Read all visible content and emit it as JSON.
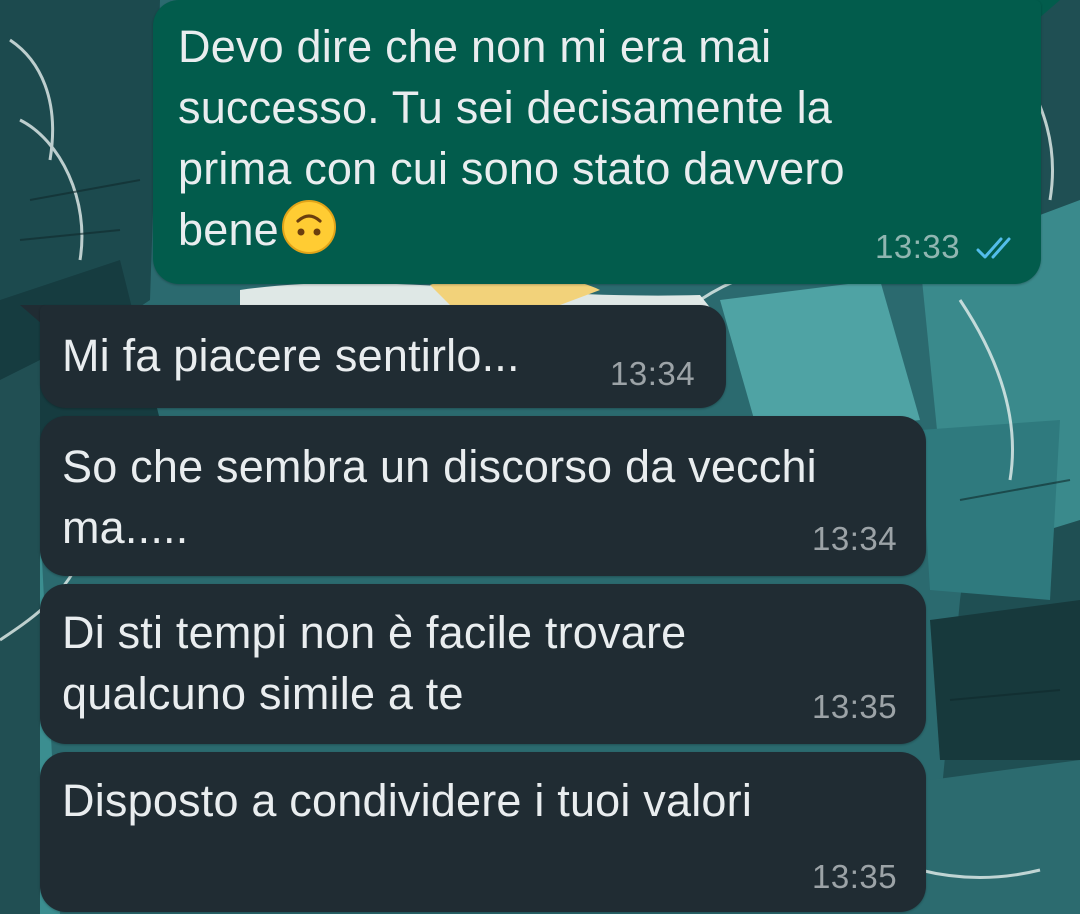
{
  "theme": {
    "outgoing_bubble": "#025c4c",
    "incoming_bubble": "#202c33",
    "read_ticks": "#53bdeb"
  },
  "messages": [
    {
      "direction": "outgoing",
      "text": "Devo dire che non mi era mai successo. Tu sei decisamente la prima con cui sono stato davvero bene",
      "lines": [
        "Devo dire che non mi era mai",
        "successo. Tu sei decisamente la",
        "prima con cui sono stato davvero",
        "bene"
      ],
      "emoji": "upside-down-face",
      "time": "13:33",
      "status": "read"
    },
    {
      "direction": "incoming",
      "text": "Mi fa piacere sentirlo...",
      "time": "13:34"
    },
    {
      "direction": "incoming",
      "text": "So che sembra un discorso da vecchi ma.....",
      "lines": [
        "So che sembra un discorso da vecchi",
        "ma....."
      ],
      "time": "13:34"
    },
    {
      "direction": "incoming",
      "text": "Di sti tempi non è facile trovare qualcuno simile a te",
      "lines": [
        "Di sti tempi non è facile trovare",
        "qualcuno simile a te"
      ],
      "time": "13:35"
    },
    {
      "direction": "incoming",
      "text": "Disposto a condividere i tuoi valori",
      "time": "13:35"
    }
  ]
}
